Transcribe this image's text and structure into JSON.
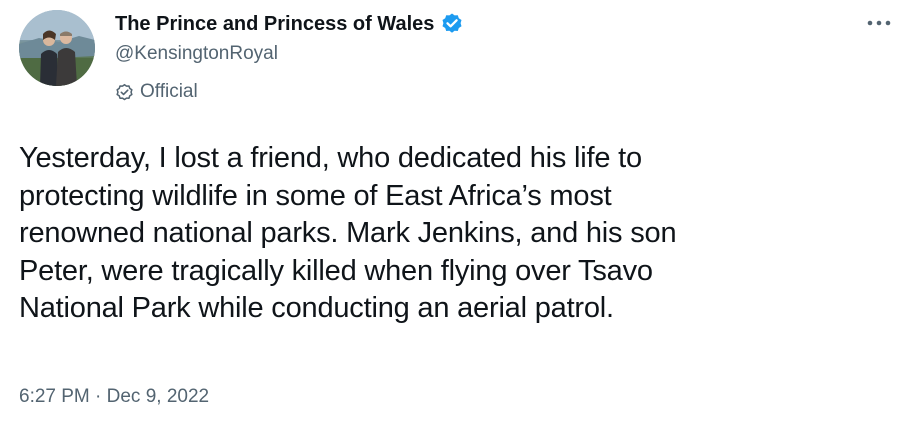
{
  "tweet": {
    "author": {
      "display_name": "The Prince and Princess of Wales",
      "handle": "@KensingtonRoyal",
      "verified": true,
      "label": "Official",
      "avatar": "couple-portrait-avatar"
    },
    "more_icon": "more-horizontal-icon",
    "text": "Yesterday, I lost a friend, who dedicated his life to\nprotecting wildlife in some of East Africa’s most\nrenowned national parks. Mark Jenkins, and his son\nPeter, were tragically killed when flying over Tsavo\nNational Park while conducting an aerial patrol.",
    "timestamp": "6:27 PM · Dec 9, 2022"
  },
  "colors": {
    "verified_blue": "#1d9bf0",
    "secondary_text": "#536471",
    "primary_text": "#0f1419",
    "background": "#ffffff"
  }
}
